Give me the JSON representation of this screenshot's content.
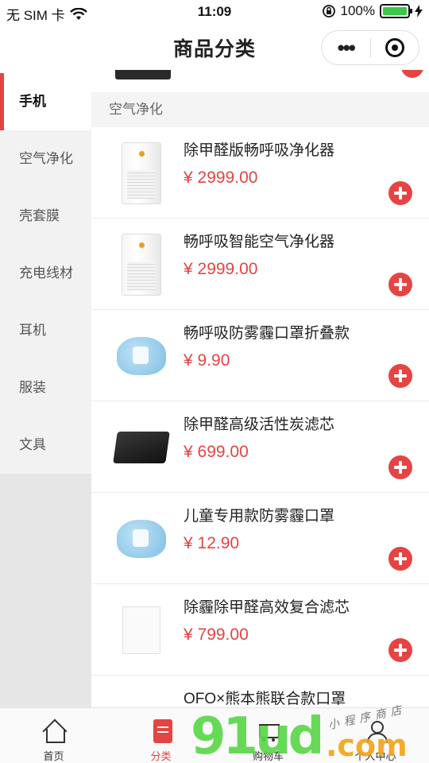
{
  "status_bar": {
    "carrier": "无 SIM 卡",
    "time": "11:09",
    "battery_percent": "100%",
    "battery_level": 1.0
  },
  "navbar": {
    "title": "商品分类",
    "more_icon": "more-dots-icon",
    "close_icon": "target-icon"
  },
  "sidebar": {
    "items": [
      {
        "label": "手机",
        "active": true
      },
      {
        "label": "空气净化",
        "active": false
      },
      {
        "label": "壳套膜",
        "active": false
      },
      {
        "label": "充电线材",
        "active": false
      },
      {
        "label": "耳机",
        "active": false
      },
      {
        "label": "服装",
        "active": false
      },
      {
        "label": "文具",
        "active": false
      }
    ]
  },
  "section": {
    "title": "空气净化"
  },
  "products": [
    {
      "name": "除甲醛版畅呼吸净化器",
      "price": "¥ 2999.00",
      "image": "air-purifier"
    },
    {
      "name": "畅呼吸智能空气净化器",
      "price": "¥ 2999.00",
      "image": "air-purifier"
    },
    {
      "name": "畅呼吸防雾霾口罩折叠款",
      "price": "¥ 9.90",
      "image": "mask"
    },
    {
      "name": "除甲醛高级活性炭滤芯",
      "price": "¥ 699.00",
      "image": "carbon-filter"
    },
    {
      "name": "儿童专用款防雾霾口罩",
      "price": "¥ 12.90",
      "image": "mask"
    },
    {
      "name": "除霾除甲醛高效复合滤芯",
      "price": "¥ 799.00",
      "image": "filter"
    },
    {
      "name": "OFO×熊本熊联合款口罩",
      "price": "",
      "image": "mask-box"
    }
  ],
  "tabbar": {
    "tabs": [
      {
        "label": "首页",
        "icon": "home-icon"
      },
      {
        "label": "分类",
        "icon": "category-icon",
        "active": true
      },
      {
        "label": "购物车",
        "icon": "cart-icon"
      },
      {
        "label": "个人中心",
        "icon": "user-icon"
      }
    ]
  },
  "watermark": {
    "logo_text": "91ud",
    "domain_suffix": ".com",
    "tagline": "小程序商店"
  },
  "colors": {
    "accent": "#e64343",
    "sidebar_bg": "#f2f2f2",
    "battery": "#39c84a"
  }
}
